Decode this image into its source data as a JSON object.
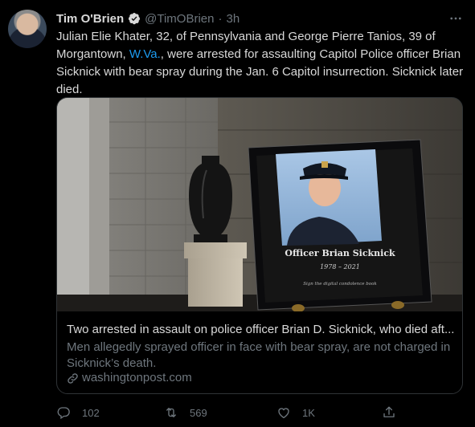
{
  "author": {
    "name": "Tim O'Brien",
    "handle": "@TimOBrien",
    "separator": "·",
    "time": "3h"
  },
  "tweet": {
    "text_before_link": "Julian Elie Khater, 32, of Pennsylvania and George Pierre Tanios, 39 of Morgantown, ",
    "link_text": "W.Va.",
    "text_after_link": ", were arrested for assaulting Capitol Police officer Brian Sicknick with bear spray during the Jan. 6 Capitol insurrection. Sicknick later died."
  },
  "card": {
    "image_caption_name": "Officer Brian Sicknick",
    "image_caption_years": "1978 – 2021",
    "image_caption_note": "Sign the digital condolence book",
    "title": "Two arrested in assault on police officer Brian D. Sicknick, who died aft...",
    "description": "Men allegedly sprayed officer in face with bear spray, are not charged in Sicknick’s death.",
    "domain": "washingtonpost.com"
  },
  "actions": {
    "reply_count": "102",
    "retweet_count": "569",
    "like_count": "1K"
  },
  "icons": {
    "verified": "verified-badge-icon",
    "more": "more-icon",
    "link": "link-icon",
    "reply": "reply-icon",
    "retweet": "retweet-icon",
    "like": "heart-icon",
    "share": "share-icon"
  },
  "colors": {
    "background": "#000000",
    "text": "#d9d9d9",
    "muted": "#6e767d",
    "link": "#1d9bf0",
    "border": "#2f3336"
  }
}
